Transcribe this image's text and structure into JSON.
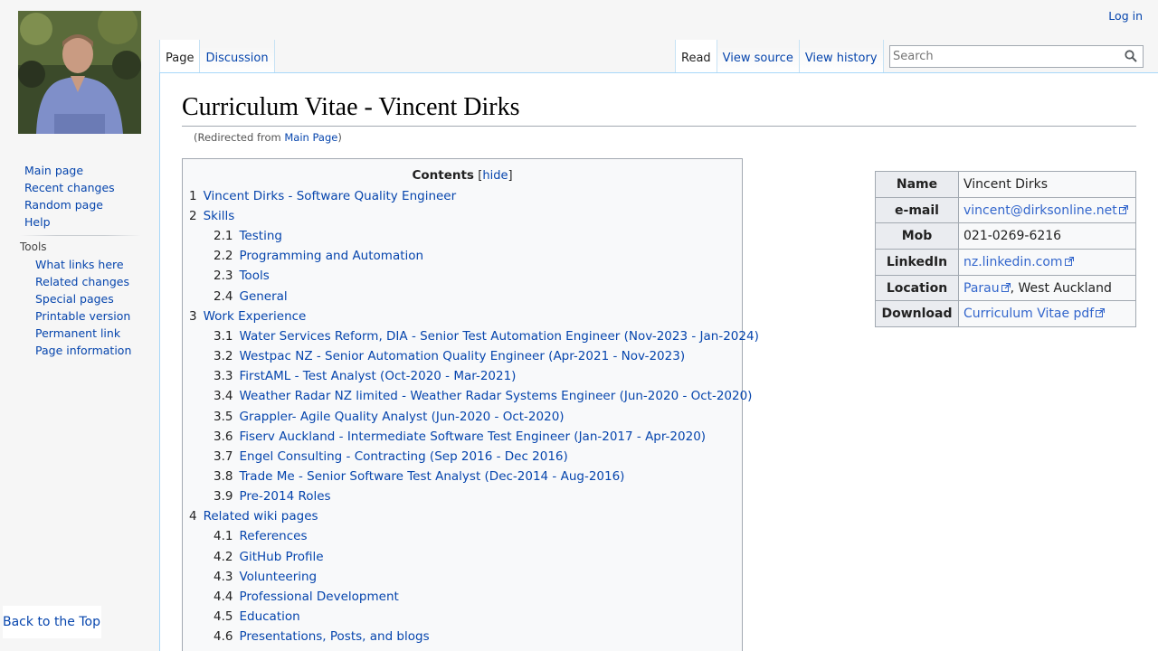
{
  "personal": {
    "login": "Log in"
  },
  "tabs": {
    "left": [
      {
        "label": "Page",
        "selected": true
      },
      {
        "label": "Discussion",
        "selected": false
      }
    ],
    "right": [
      {
        "label": "Read",
        "selected": true
      },
      {
        "label": "View source",
        "selected": false
      },
      {
        "label": "View history",
        "selected": false
      }
    ]
  },
  "search": {
    "placeholder": "Search",
    "value": ""
  },
  "sidebar": {
    "nav": [
      "Main page",
      "Recent changes",
      "Random page",
      "Help"
    ],
    "tools_heading": "Tools",
    "tools": [
      "What links here",
      "Related changes",
      "Special pages",
      "Printable version",
      "Permanent link",
      "Page information"
    ],
    "back_to_top": "Back to the Top"
  },
  "page": {
    "title": "Curriculum Vitae - Vincent Dirks",
    "redirect_prefix": "(Redirected from ",
    "redirect_link": "Main Page",
    "redirect_suffix": ")"
  },
  "toc": {
    "title": "Contents",
    "hide_open": "[",
    "hide_label": "hide",
    "hide_close": "]",
    "sections": [
      {
        "num": "1",
        "label": "Vincent Dirks - Software Quality Engineer",
        "subs": []
      },
      {
        "num": "2",
        "label": "Skills",
        "subs": [
          {
            "num": "2.1",
            "label": "Testing"
          },
          {
            "num": "2.2",
            "label": "Programming and Automation"
          },
          {
            "num": "2.3",
            "label": "Tools"
          },
          {
            "num": "2.4",
            "label": "General"
          }
        ]
      },
      {
        "num": "3",
        "label": "Work Experience",
        "subs": [
          {
            "num": "3.1",
            "label": "Water Services Reform, DIA - Senior Test Automation Engineer (Nov-2023 - Jan-2024)"
          },
          {
            "num": "3.2",
            "label": "Westpac NZ - Senior Automation Quality Engineer (Apr-2021 - Nov-2023)"
          },
          {
            "num": "3.3",
            "label": "FirstAML - Test Analyst (Oct-2020 - Mar-2021)"
          },
          {
            "num": "3.4",
            "label": "Weather Radar NZ limited - Weather Radar Systems Engineer (Jun-2020 - Oct-2020)"
          },
          {
            "num": "3.5",
            "label": "Grappler- Agile Quality Analyst (Jun-2020 - Oct-2020)"
          },
          {
            "num": "3.6",
            "label": "Fiserv Auckland - Intermediate Software Test Engineer (Jan-2017 - Apr-2020)"
          },
          {
            "num": "3.7",
            "label": "Engel Consulting - Contracting (Sep 2016 - Dec 2016)"
          },
          {
            "num": "3.8",
            "label": "Trade Me - Senior Software Test Analyst (Dec-2014 - Aug-2016)"
          },
          {
            "num": "3.9",
            "label": "Pre-2014 Roles"
          }
        ]
      },
      {
        "num": "4",
        "label": "Related wiki pages",
        "subs": [
          {
            "num": "4.1",
            "label": "References"
          },
          {
            "num": "4.2",
            "label": "GitHub Profile"
          },
          {
            "num": "4.3",
            "label": "Volunteering"
          },
          {
            "num": "4.4",
            "label": "Professional Development"
          },
          {
            "num": "4.5",
            "label": "Education"
          },
          {
            "num": "4.6",
            "label": "Presentations, Posts, and blogs"
          }
        ]
      }
    ]
  },
  "infobox": [
    {
      "label": "Name",
      "value": "Vincent Dirks",
      "link": false,
      "suffix": ""
    },
    {
      "label": "e-mail",
      "value": "vincent@dirksonline.net",
      "link": true,
      "suffix": ""
    },
    {
      "label": "Mob",
      "value": "021-0269-6216",
      "link": false,
      "suffix": ""
    },
    {
      "label": "LinkedIn",
      "value": "nz.linkedin.com",
      "link": true,
      "suffix": ""
    },
    {
      "label": "Location",
      "value": "Parau",
      "link": true,
      "suffix": ", West Auckland"
    },
    {
      "label": "Download",
      "value": "Curriculum Vitae pdf",
      "link": true,
      "suffix": ""
    }
  ],
  "icons": {
    "search": "search-icon",
    "external": "external-link-icon",
    "logo": "profile-photo"
  },
  "colors": {
    "link": "#0645ad",
    "external_link": "#3366cc",
    "tab_border": "#a7d7f9"
  }
}
